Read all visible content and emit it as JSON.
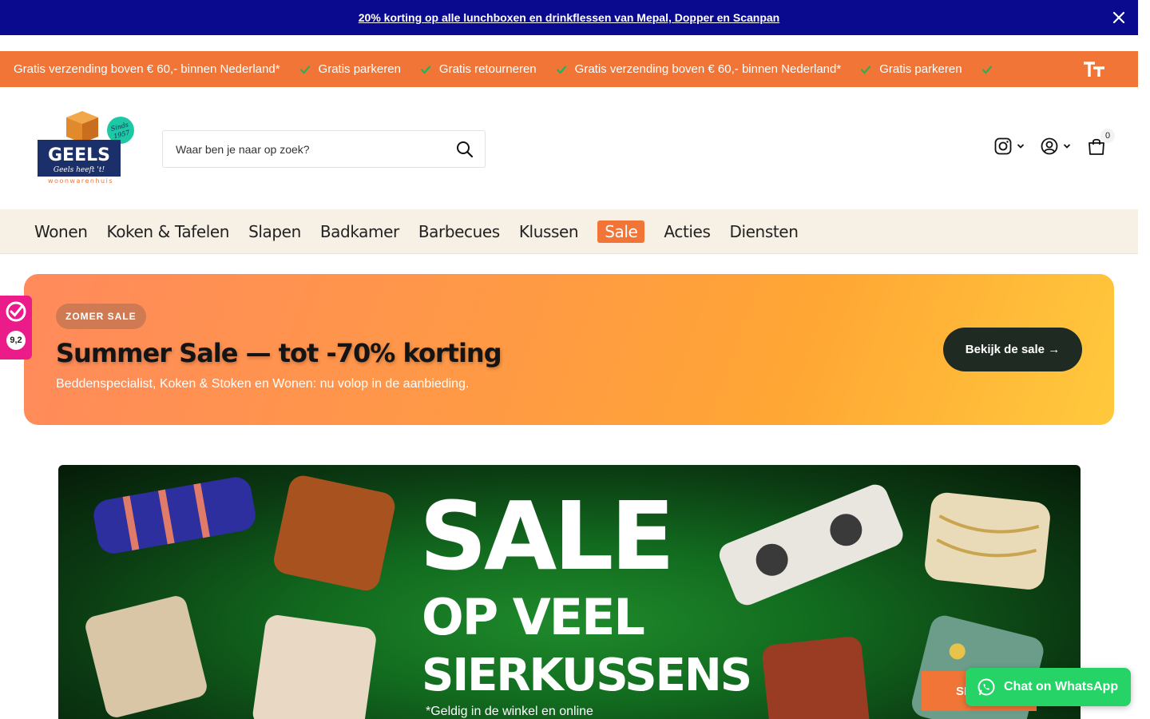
{
  "announcement": {
    "text": "20% korting op alle lunchboxen en drinkflessen van Mepal, Dopper en Scanpan",
    "close_icon": "close-icon"
  },
  "usp_bar": {
    "items": [
      "Gratis verzending boven € 60,- binnen Nederland*",
      "Gratis parkeren",
      "Gratis retourneren",
      "Gratis verzending boven € 60,- binnen Nederland*",
      "Gratis parkeren"
    ],
    "check_icon": "check-icon",
    "text_size_icon": "text-size-icon"
  },
  "header": {
    "logo": {
      "brand": "GEELS",
      "tagline": "Geels heeft 't!",
      "sub": "woonwarenhuis",
      "badge": "Sinds 1957"
    },
    "search": {
      "placeholder": "Waar ben je naar op zoek?"
    },
    "cart_count": "0"
  },
  "nav": {
    "items": [
      "Wonen",
      "Koken & Tafelen",
      "Slapen",
      "Badkamer",
      "Barbecues",
      "Klussen",
      "Sale",
      "Acties",
      "Diensten"
    ]
  },
  "rating": {
    "score": "9,2"
  },
  "promo": {
    "pill": "ZOMER SALE",
    "title": "Summer Sale — tot -70% korting",
    "subtitle": "Beddenspecialist, Koken & Stoken en Wonen: nu volop in de aanbieding.",
    "cta": "Bekijk de sale →"
  },
  "hero": {
    "line1": "SALE",
    "line2": "OP VEEL",
    "line3": "SIERKUSSENS",
    "note": "*Geldig in de winkel en online"
  },
  "floating": {
    "shop_label": "SI",
    "whatsapp_label": "Chat on WhatsApp"
  },
  "colors": {
    "announcement_bg": "#0a0a8f",
    "usp_bg": "#f07537",
    "nav_bg": "#f6f0e5",
    "accent": "#f07537",
    "whatsapp": "#25d366",
    "rating_bg": "#ec1b8a"
  }
}
